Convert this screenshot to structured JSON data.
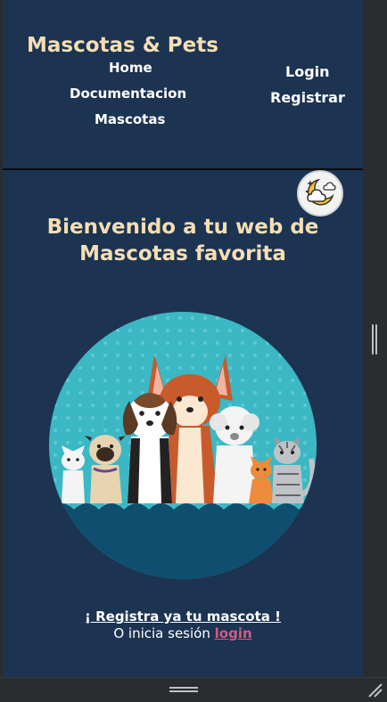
{
  "header": {
    "brand": "Mascotas & Pets",
    "nav_left": [
      "Home",
      "Documentacion",
      "Mascotas"
    ],
    "nav_right": [
      "Login",
      "Registrar"
    ]
  },
  "theme_toggle": {
    "icon": "moon-cloud-icon"
  },
  "hero": {
    "title_line1": "Bienvenido a tu web de",
    "title_line2": "Mascotas favorita",
    "illustration": "pets-group-illustration"
  },
  "cta": {
    "register_text": "¡ Registra ya tu mascota !",
    "login_prefix": "O inicia sesión",
    "login_link": "login"
  },
  "colors": {
    "background": "#1c3351",
    "accent_text": "#f5deb3",
    "link_pink": "#d05d85",
    "circle_teal": "#3bb8c4"
  }
}
